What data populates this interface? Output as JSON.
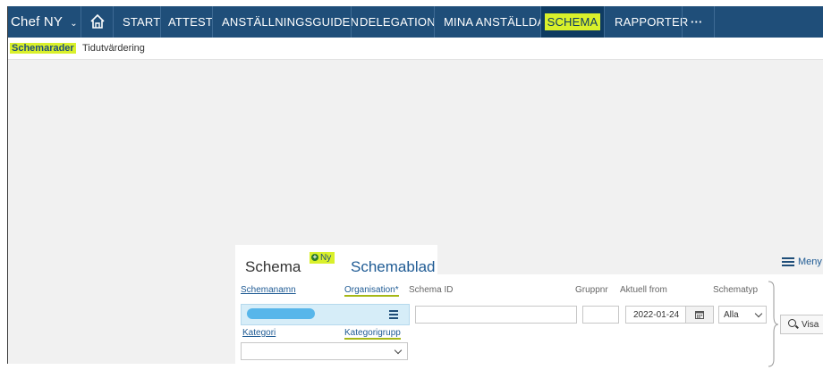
{
  "nav": {
    "brand": "Chef NY",
    "items": [
      "START",
      "ATTEST",
      "ANSTÄLLNINGSGUIDEN",
      "DELEGATION",
      "MINA ANSTÄLLDA",
      "SCHEMA",
      "RAPPORTER"
    ],
    "more": "···",
    "active": "SCHEMA"
  },
  "subnav": {
    "items": [
      "Schemarader",
      "Tidutvärdering"
    ],
    "active": "Schemarader"
  },
  "tabs": {
    "schema": "Schema",
    "new": "Ny",
    "schemablad": "Schemablad"
  },
  "menu": {
    "label": "Meny"
  },
  "form": {
    "schemanamn_label": "Schemanamn",
    "organisation_label": "Organisation",
    "required_mark": "*",
    "schema_id_label": "Schema ID",
    "gruppnr_label": "Gruppnr",
    "aktuell_from_label": "Aktuell from",
    "aktuell_from_value": "2022-01-24",
    "schematyp_label": "Schematyp",
    "schematyp_value": "Alla",
    "kategori_label": "Kategori",
    "kategorigrupp_label": "Kategorigrupp",
    "visa_label": "Visa"
  },
  "colors": {
    "nav_bg": "#1f4e79",
    "highlight": "#d9f02b",
    "link": "#1f5b94"
  },
  "icons": [
    "home-icon",
    "chevron-down-icon",
    "plus-circle-icon",
    "hamburger-icon",
    "calendar-icon",
    "search-icon"
  ]
}
